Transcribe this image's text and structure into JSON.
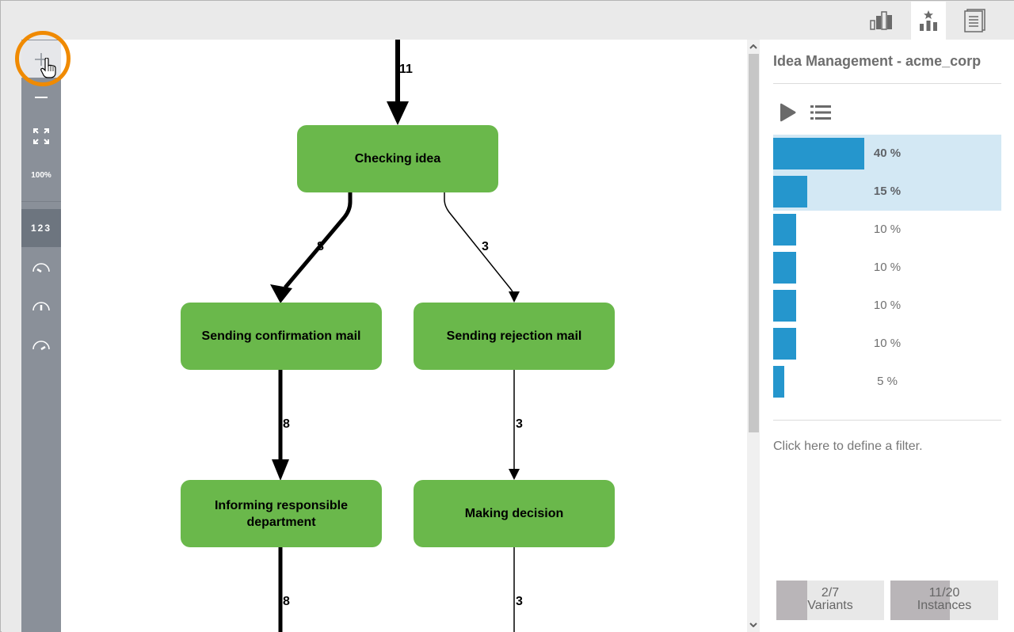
{
  "topbar": {
    "tabs": [
      {
        "name": "statistics",
        "icon": "bar-chart-icon",
        "active": false
      },
      {
        "name": "variants",
        "icon": "ranked-bars-star-icon",
        "active": true
      },
      {
        "name": "documents",
        "icon": "document-stack-icon",
        "active": false
      }
    ]
  },
  "toolbar": {
    "zoom_in": "+",
    "zoom_out": "—",
    "fit": "fit-screen-icon",
    "zoom_reset": "100%",
    "show_numbers": "123",
    "speed_slow": "gauge-slow-icon",
    "speed_medium": "gauge-medium-icon",
    "speed_fast": "gauge-fast-icon"
  },
  "diagram": {
    "nodes": [
      {
        "id": "checking",
        "label": "Checking idea"
      },
      {
        "id": "confirm",
        "label": "Sending confirmation mail"
      },
      {
        "id": "reject",
        "label": "Sending rejection mail"
      },
      {
        "id": "inform",
        "label": "Informing responsible department"
      },
      {
        "id": "decide",
        "label": "Making decision"
      }
    ],
    "edges": [
      {
        "from": "start",
        "to": "checking",
        "count": "11"
      },
      {
        "from": "checking",
        "to": "confirm",
        "count": "8"
      },
      {
        "from": "checking",
        "to": "reject",
        "count": "3"
      },
      {
        "from": "confirm",
        "to": "inform",
        "count": "8"
      },
      {
        "from": "reject",
        "to": "decide",
        "count": "3"
      },
      {
        "from": "inform",
        "to": "next",
        "count": "8"
      },
      {
        "from": "decide",
        "to": "next",
        "count": "3"
      }
    ],
    "colors": {
      "node": "#6ab84b",
      "edge": "#000000"
    }
  },
  "panel": {
    "title": "Idea Management - acme_corp",
    "play_icon": "play-icon",
    "list_icon": "list-icon",
    "variants": [
      {
        "label": "40 %",
        "share": 0.4,
        "selected": true
      },
      {
        "label": "15 %",
        "share": 0.15,
        "selected": true
      },
      {
        "label": "10 %",
        "share": 0.1,
        "selected": false
      },
      {
        "label": "10 %",
        "share": 0.1,
        "selected": false
      },
      {
        "label": "10 %",
        "share": 0.1,
        "selected": false
      },
      {
        "label": "10 %",
        "share": 0.1,
        "selected": false
      },
      {
        "label": "5 %",
        "share": 0.05,
        "selected": false
      }
    ],
    "filter_text": "Click here to define a filter.",
    "variants_counter": {
      "value": "2/7",
      "label": "Variants",
      "fraction": 0.2857
    },
    "instances_counter": {
      "value": "11/20",
      "label": "Instances",
      "fraction": 0.55
    },
    "colors": {
      "bar": "#2596cd",
      "selected_bg": "#d3e8f4"
    }
  }
}
